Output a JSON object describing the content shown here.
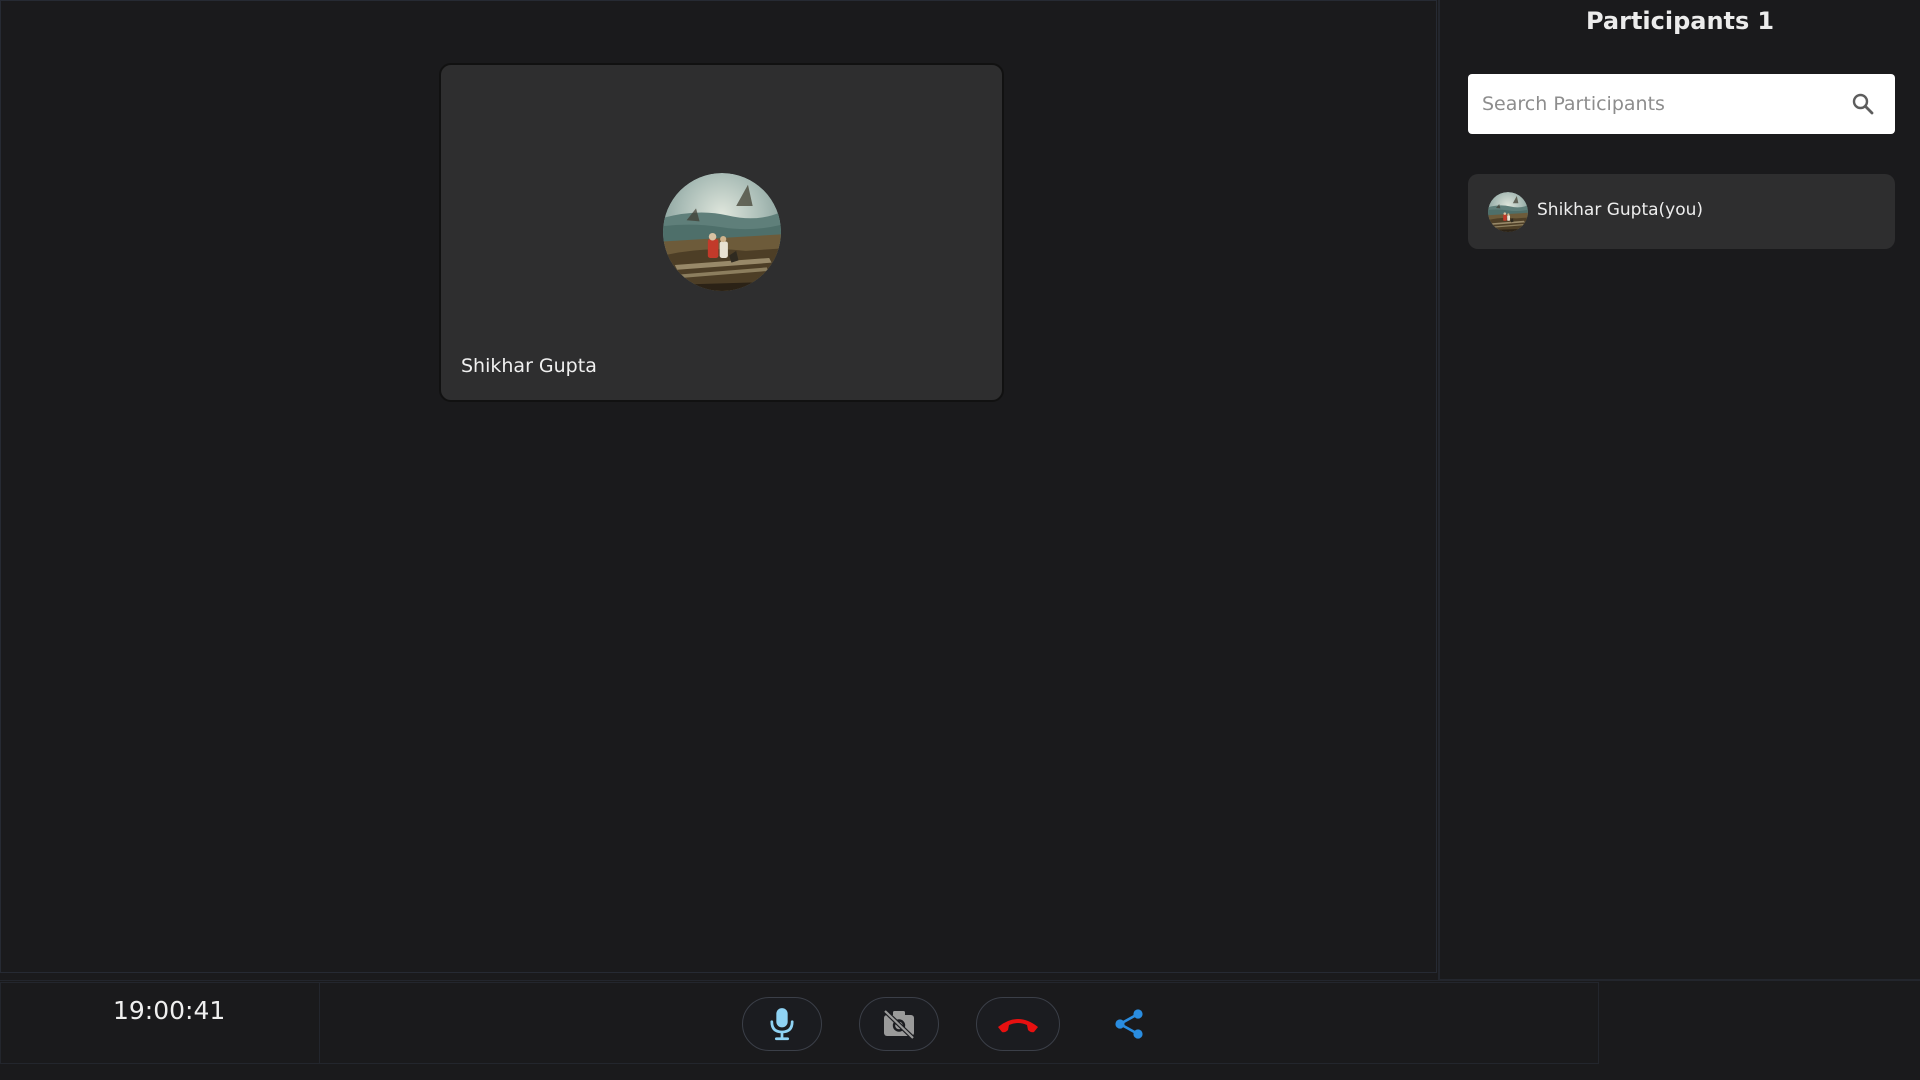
{
  "participants_panel": {
    "title": "Participants",
    "count": "1",
    "search": {
      "placeholder": "Search Participants",
      "value": ""
    },
    "items": [
      {
        "label": "Shikhar Gupta(you)",
        "avatar_icon": "painting-avatar-icon"
      }
    ]
  },
  "stage": {
    "tiles": [
      {
        "name": "Shikhar Gupta",
        "avatar_icon": "painting-avatar-icon"
      }
    ]
  },
  "bottom_bar": {
    "clock": "19:00:41",
    "controls": {
      "mic": {
        "icon": "microphone-icon",
        "color": "#8fd3f4"
      },
      "camera": {
        "icon": "camera-off-icon",
        "color": "#9a9a9a"
      },
      "end_call": {
        "icon": "end-call-icon",
        "color": "#e81010"
      },
      "share": {
        "icon": "share-icon",
        "color": "#2a8de0"
      }
    }
  },
  "colors": {
    "background": "#1a1a1c",
    "tile": "#2e2e2f",
    "search_bg": "#ffffff"
  }
}
